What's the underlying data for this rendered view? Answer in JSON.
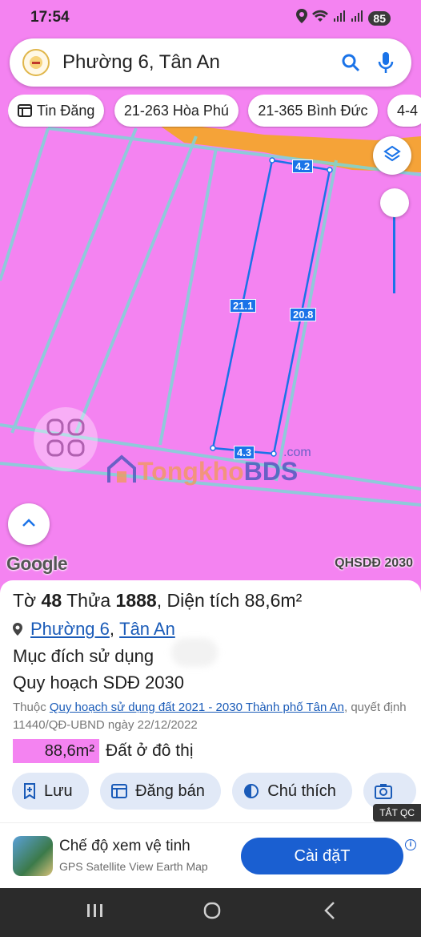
{
  "status_bar": {
    "time": "17:54",
    "battery": "85"
  },
  "search": {
    "query": "Phường 6, Tân An"
  },
  "chips": [
    {
      "label": "Tin Đăng",
      "icon": "listing-icon"
    },
    {
      "label": "21-263 Hòa Phú"
    },
    {
      "label": "21-365 Bình Đức"
    },
    {
      "label": "4-4"
    }
  ],
  "map": {
    "plot_dimensions": {
      "top": "4.2",
      "left": "21.1",
      "right": "20.8",
      "bottom": "4.3"
    },
    "watermark": {
      "part1": "Tongkho",
      "part2": "BDS",
      "suffix": ".com"
    },
    "google_label": "Google",
    "layer_label": "QHSDĐ 2030",
    "land_color": "#f483f1",
    "road_color": "#f5a623",
    "plot_outline_color": "#1a73e8"
  },
  "parcel": {
    "title_prefix": "Tờ",
    "sheet_no": "48",
    "title_mid": "Thửa",
    "parcel_no": "1888",
    "title_suffix": ", Diện tích",
    "area": "88,6m²",
    "ward": "Phường 6",
    "city": "Tân An",
    "purpose_label": "Mục đích sử dụng",
    "plan_label": "Quy hoạch SDĐ 2030",
    "source_prefix": "Thuộc",
    "source_link": "Quy hoạch sử dụng đất 2021 - 2030 Thành phố Tân An",
    "source_decision": ", quyết định 11440/QĐ-UBND ngày 22/12/2022",
    "zone_area": "88,6m²",
    "zone_label": "Đất ở đô thị",
    "zone_color": "#f483f1"
  },
  "actions": [
    {
      "label": "Lưu",
      "icon": "save-icon"
    },
    {
      "label": "Đăng bán",
      "icon": "post-icon"
    },
    {
      "label": "Chú thích",
      "icon": "legend-icon"
    },
    {
      "label": "",
      "icon": "camera-icon"
    }
  ],
  "ad": {
    "close_label": "TẮT QC",
    "title": "Chế độ xem vệ tinh",
    "subtitle": "GPS Satellite View Earth Map",
    "cta": "Cài đặT"
  }
}
